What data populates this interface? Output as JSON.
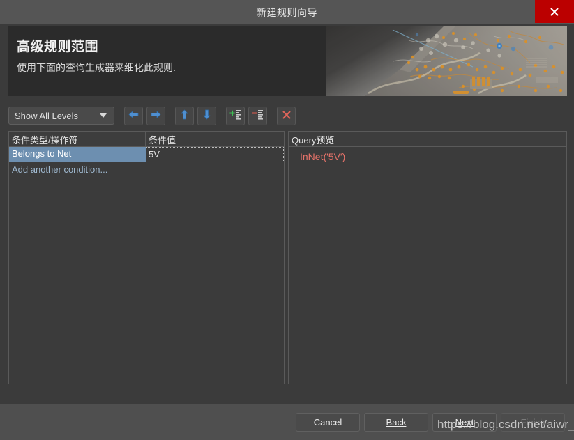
{
  "window": {
    "title": "新建规则向导",
    "close_icon": "close-icon"
  },
  "header": {
    "title": "高级规则范围",
    "subtitle": "使用下面的查询生成器来细化此规则.",
    "banner_art": "pcb-circuit-board-image"
  },
  "toolbar": {
    "level_filter": {
      "value": "Show All Levels",
      "arrow_icon": "chevron-down-icon"
    },
    "buttons": [
      {
        "name": "move-left-button",
        "icon": "arrow-left-icon",
        "title": "Move Left"
      },
      {
        "name": "move-right-button",
        "icon": "arrow-right-icon",
        "title": "Move Right"
      },
      {
        "name": "move-up-button",
        "icon": "arrow-up-icon",
        "title": "Move Up"
      },
      {
        "name": "move-down-button",
        "icon": "arrow-down-icon",
        "title": "Move Down"
      },
      {
        "name": "add-condition-button",
        "icon": "add-row-icon",
        "title": "Add Condition"
      },
      {
        "name": "remove-condition-button",
        "icon": "remove-row-icon",
        "title": "Remove Condition"
      },
      {
        "name": "clear-all-button",
        "icon": "red-x-icon",
        "title": "Clear All"
      }
    ]
  },
  "conditions_panel": {
    "columns": [
      "条件类型/操作符",
      "条件值"
    ],
    "rows": [
      {
        "type": "Belongs to Net",
        "value": "5V",
        "selected": true
      }
    ],
    "add_row_label": "Add another condition..."
  },
  "query_panel": {
    "header": "Query预览",
    "query": "InNet('5V')"
  },
  "footer": {
    "buttons": [
      {
        "name": "cancel-button",
        "label": "Cancel",
        "disabled": false,
        "accel": ""
      },
      {
        "name": "back-button",
        "label": "Back",
        "disabled": false,
        "accel": "B"
      },
      {
        "name": "next-button",
        "label": "Next",
        "disabled": false,
        "accel": "N"
      },
      {
        "name": "finish-button",
        "label": "Finish",
        "disabled": true,
        "accel": ""
      }
    ]
  },
  "watermark": "https://blog.csdn.net/aiwr_",
  "colors": {
    "accent_selection": "#6d8fb0",
    "query_text": "#e8736a",
    "close_red": "#bb0000",
    "link_blue": "#9fb9d0"
  }
}
